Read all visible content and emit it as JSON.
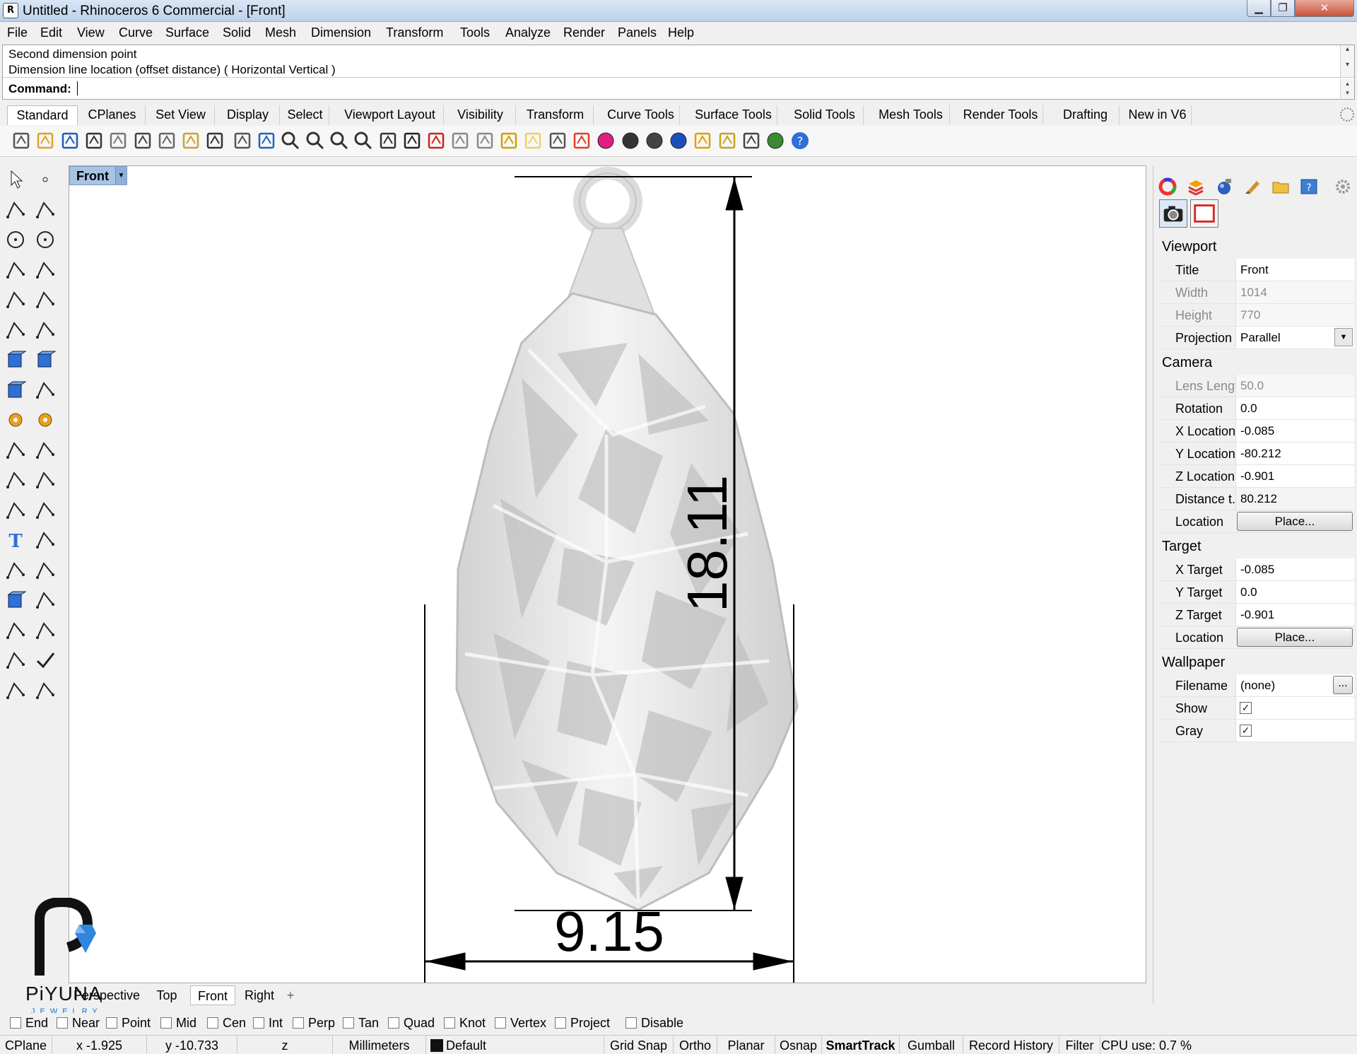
{
  "window": {
    "title": "Untitled - Rhinoceros 6 Commercial - [Front]",
    "min_glyph": "▁",
    "max_glyph": "❐",
    "close_glyph": "✕"
  },
  "menu": [
    "File",
    "Edit",
    "View",
    "Curve",
    "Surface",
    "Solid",
    "Mesh",
    "Dimension",
    "Transform",
    "Tools",
    "Analyze",
    "Render",
    "Panels",
    "Help"
  ],
  "command": {
    "history": [
      "Second dimension point",
      "Dimension line location (offset distance) ( Horizontal  Vertical )"
    ],
    "prompt_label": "Command:",
    "input_value": ""
  },
  "toolbar_tabs": [
    "Standard",
    "CPlanes",
    "Set View",
    "Display",
    "Select",
    "Viewport Layout",
    "Visibility",
    "Transform",
    "Curve Tools",
    "Surface Tools",
    "Solid Tools",
    "Mesh Tools",
    "Render Tools",
    "Drafting",
    "New in V6"
  ],
  "standard_icons": [
    "new-icon",
    "open-icon",
    "save-icon",
    "print-icon",
    "import-icon",
    "cut-icon",
    "copy-icon",
    "paste-icon",
    "undo-icon",
    "pan-icon",
    "rotate-view-icon",
    "zoom-icon",
    "zoom-window-icon",
    "zoom-extents-icon",
    "zoom-selected-icon",
    "undo-view-icon",
    "viewport-layout-icon",
    "car-icon",
    "grid-icon",
    "cplane-icon",
    "object-snap-icon",
    "light-icon",
    "lock-icon",
    "layer-icon",
    "color-wheel-icon",
    "shaded-sphere-icon",
    "rendered-sphere-icon",
    "blue-sphere-icon",
    "filter-icon",
    "gear-icon",
    "dimension-icon",
    "globe-icon",
    "help-icon"
  ],
  "viewport": {
    "title": "Front",
    "dim_vertical": "18.11",
    "dim_horizontal": "9.15"
  },
  "properties": {
    "viewport_header": "Viewport",
    "title_label": "Title",
    "title_value": "Front",
    "width_label": "Width",
    "width_value": "1014",
    "height_label": "Height",
    "height_value": "770",
    "projection_label": "Projection",
    "projection_value": "Parallel",
    "camera_header": "Camera",
    "lens_label": "Lens Length",
    "lens_value": "50.0",
    "rotation_label": "Rotation",
    "rotation_value": "0.0",
    "xloc_label": "X Location",
    "xloc_value": "-0.085",
    "yloc_label": "Y Location",
    "yloc_value": "-80.212",
    "zloc_label": "Z Location",
    "zloc_value": "-0.901",
    "dist_label": "Distance t...",
    "dist_value": "80.212",
    "location_label": "Location",
    "place_button": "Place...",
    "target_header": "Target",
    "xt_label": "X Target",
    "xt_value": "-0.085",
    "yt_label": "Y Target",
    "yt_value": "0.0",
    "zt_label": "Z Target",
    "zt_value": "-0.901",
    "target_location_label": "Location",
    "wallpaper_header": "Wallpaper",
    "filename_label": "Filename",
    "filename_value": "(none)",
    "browse_button": "...",
    "show_label": "Show",
    "show_checked": true,
    "gray_label": "Gray",
    "gray_checked": true
  },
  "view_tabs": [
    "Perspective",
    "Top",
    "Front",
    "Right",
    "+"
  ],
  "osnaps": [
    "End",
    "Near",
    "Point",
    "Mid",
    "Cen",
    "Int",
    "Perp",
    "Tan",
    "Quad",
    "Knot",
    "Vertex",
    "Project",
    "Disable"
  ],
  "status": {
    "cplane": "CPlane",
    "x": "x -1.925",
    "y": "y -10.733",
    "z": "z",
    "units": "Millimeters",
    "layer": "Default",
    "grid_snap": "Grid Snap",
    "ortho": "Ortho",
    "planar": "Planar",
    "osnap": "Osnap",
    "smarttrack": "SmartTrack",
    "gumball": "Gumball",
    "record_history": "Record History",
    "filter": "Filter",
    "cpu": "CPU use: 0.7 %"
  },
  "logo": {
    "name": "PiYUNA",
    "sub": "JEWELRY"
  },
  "colors": {
    "viewport_title_bg": "#a9c3e4",
    "accent_blue": "#1e6fc6",
    "model_gray": "#e4e4e4"
  }
}
